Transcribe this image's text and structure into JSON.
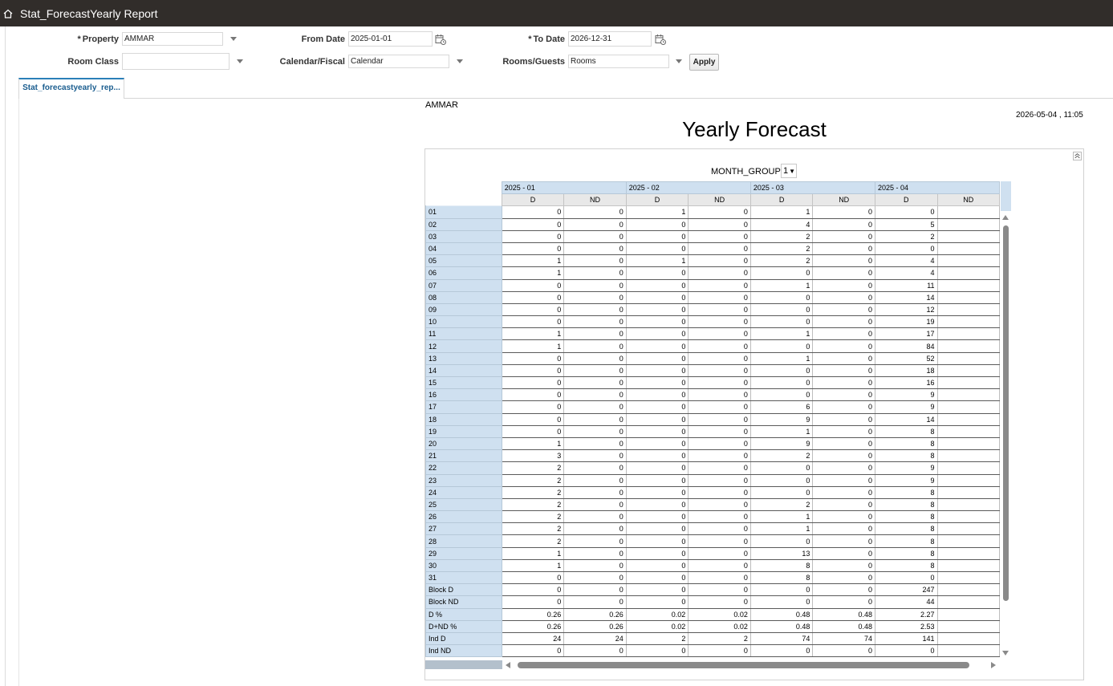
{
  "app": {
    "title": "Stat_ForecastYearly Report"
  },
  "form": {
    "property_label": "Property",
    "property_value": "AMMAR",
    "from_date_label": "From Date",
    "from_date_value": "2025-01-01",
    "to_date_label": "To Date",
    "to_date_value": "2026-12-31",
    "room_class_label": "Room Class",
    "room_class_value": "",
    "calendar_label": "Calendar/Fiscal",
    "calendar_value": "Calendar",
    "rooms_label": "Rooms/Guests",
    "rooms_value": "Rooms",
    "apply_label": "Apply"
  },
  "tab": {
    "label": "Stat_forecastyearly_rep..."
  },
  "report": {
    "property": "AMMAR",
    "generated": "2026-05-04 , 11:05",
    "title": "Yearly Forecast",
    "month_group_label": "MONTH_GROUP",
    "month_group_value": "1"
  },
  "grid": {
    "months": [
      "2025 - 01",
      "2025 - 02",
      "2025 - 03",
      "2025 - 04"
    ],
    "subcols": [
      "D",
      "ND",
      "D",
      "ND",
      "D",
      "ND",
      "D",
      "ND"
    ],
    "rows": [
      {
        "label": "01",
        "values": [
          "0",
          "0",
          "1",
          "0",
          "1",
          "0",
          "0",
          ""
        ]
      },
      {
        "label": "02",
        "values": [
          "0",
          "0",
          "0",
          "0",
          "4",
          "0",
          "5",
          ""
        ]
      },
      {
        "label": "03",
        "values": [
          "0",
          "0",
          "0",
          "0",
          "2",
          "0",
          "2",
          ""
        ]
      },
      {
        "label": "04",
        "values": [
          "0",
          "0",
          "0",
          "0",
          "2",
          "0",
          "0",
          ""
        ]
      },
      {
        "label": "05",
        "values": [
          "1",
          "0",
          "1",
          "0",
          "2",
          "0",
          "4",
          ""
        ]
      },
      {
        "label": "06",
        "values": [
          "1",
          "0",
          "0",
          "0",
          "0",
          "0",
          "4",
          ""
        ]
      },
      {
        "label": "07",
        "values": [
          "0",
          "0",
          "0",
          "0",
          "1",
          "0",
          "11",
          ""
        ]
      },
      {
        "label": "08",
        "values": [
          "0",
          "0",
          "0",
          "0",
          "0",
          "0",
          "14",
          ""
        ]
      },
      {
        "label": "09",
        "values": [
          "0",
          "0",
          "0",
          "0",
          "0",
          "0",
          "12",
          ""
        ]
      },
      {
        "label": "10",
        "values": [
          "0",
          "0",
          "0",
          "0",
          "0",
          "0",
          "19",
          ""
        ]
      },
      {
        "label": "11",
        "values": [
          "1",
          "0",
          "0",
          "0",
          "1",
          "0",
          "17",
          ""
        ]
      },
      {
        "label": "12",
        "values": [
          "1",
          "0",
          "0",
          "0",
          "0",
          "0",
          "84",
          ""
        ]
      },
      {
        "label": "13",
        "values": [
          "0",
          "0",
          "0",
          "0",
          "1",
          "0",
          "52",
          ""
        ]
      },
      {
        "label": "14",
        "values": [
          "0",
          "0",
          "0",
          "0",
          "0",
          "0",
          "18",
          ""
        ]
      },
      {
        "label": "15",
        "values": [
          "0",
          "0",
          "0",
          "0",
          "0",
          "0",
          "16",
          ""
        ]
      },
      {
        "label": "16",
        "values": [
          "0",
          "0",
          "0",
          "0",
          "0",
          "0",
          "9",
          ""
        ]
      },
      {
        "label": "17",
        "values": [
          "0",
          "0",
          "0",
          "0",
          "6",
          "0",
          "9",
          ""
        ]
      },
      {
        "label": "18",
        "values": [
          "0",
          "0",
          "0",
          "0",
          "9",
          "0",
          "14",
          ""
        ]
      },
      {
        "label": "19",
        "values": [
          "0",
          "0",
          "0",
          "0",
          "1",
          "0",
          "8",
          ""
        ]
      },
      {
        "label": "20",
        "values": [
          "1",
          "0",
          "0",
          "0",
          "9",
          "0",
          "8",
          ""
        ]
      },
      {
        "label": "21",
        "values": [
          "3",
          "0",
          "0",
          "0",
          "2",
          "0",
          "8",
          ""
        ]
      },
      {
        "label": "22",
        "values": [
          "2",
          "0",
          "0",
          "0",
          "0",
          "0",
          "9",
          ""
        ]
      },
      {
        "label": "23",
        "values": [
          "2",
          "0",
          "0",
          "0",
          "0",
          "0",
          "9",
          ""
        ]
      },
      {
        "label": "24",
        "values": [
          "2",
          "0",
          "0",
          "0",
          "0",
          "0",
          "8",
          ""
        ]
      },
      {
        "label": "25",
        "values": [
          "2",
          "0",
          "0",
          "0",
          "2",
          "0",
          "8",
          ""
        ]
      },
      {
        "label": "26",
        "values": [
          "2",
          "0",
          "0",
          "0",
          "1",
          "0",
          "8",
          ""
        ]
      },
      {
        "label": "27",
        "values": [
          "2",
          "0",
          "0",
          "0",
          "1",
          "0",
          "8",
          ""
        ]
      },
      {
        "label": "28",
        "values": [
          "2",
          "0",
          "0",
          "0",
          "0",
          "0",
          "8",
          ""
        ]
      },
      {
        "label": "29",
        "values": [
          "1",
          "0",
          "0",
          "0",
          "13",
          "0",
          "8",
          ""
        ]
      },
      {
        "label": "30",
        "values": [
          "1",
          "0",
          "0",
          "0",
          "8",
          "0",
          "8",
          ""
        ]
      },
      {
        "label": "31",
        "values": [
          "0",
          "0",
          "0",
          "0",
          "8",
          "0",
          "0",
          ""
        ]
      },
      {
        "label": "Block D",
        "values": [
          "0",
          "0",
          "0",
          "0",
          "0",
          "0",
          "247",
          ""
        ]
      },
      {
        "label": "Block ND",
        "values": [
          "0",
          "0",
          "0",
          "0",
          "0",
          "0",
          "44",
          ""
        ]
      },
      {
        "label": "D %",
        "values": [
          "0.26",
          "0.26",
          "0.02",
          "0.02",
          "0.48",
          "0.48",
          "2.27",
          ""
        ]
      },
      {
        "label": "D+ND %",
        "values": [
          "0.26",
          "0.26",
          "0.02",
          "0.02",
          "0.48",
          "0.48",
          "2.53",
          ""
        ]
      },
      {
        "label": "Ind D",
        "values": [
          "24",
          "24",
          "2",
          "2",
          "74",
          "74",
          "141",
          ""
        ]
      },
      {
        "label": "Ind ND",
        "values": [
          "0",
          "0",
          "0",
          "0",
          "0",
          "0",
          "0",
          ""
        ]
      }
    ]
  },
  "icons": {
    "home": "home-icon",
    "calendar": "calendar-icon",
    "dropdown": "chevron-down-icon",
    "collapse": "collapse-icon"
  }
}
